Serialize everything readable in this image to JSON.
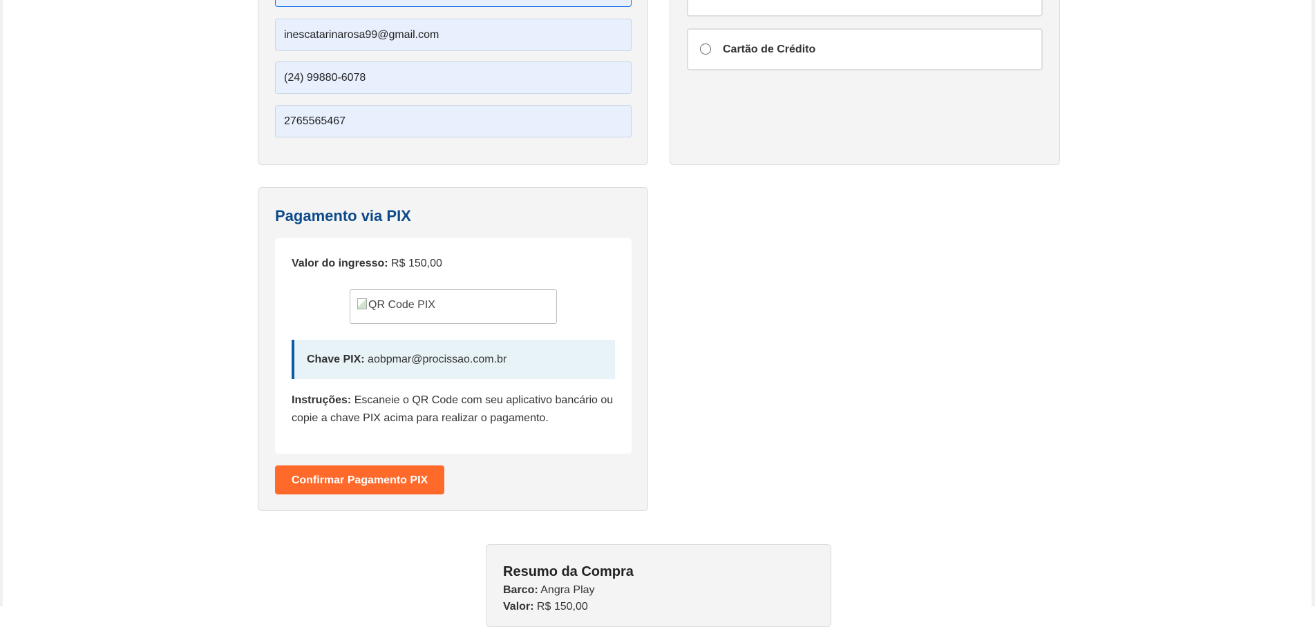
{
  "contact_form": {
    "email_value": "inescatarinarosa99@gmail.com",
    "phone_value": "(24) 99880-6078",
    "document_value": "2765565467"
  },
  "payment_methods": {
    "credit_card_label": "Cartão de Crédito"
  },
  "pix": {
    "title": "Pagamento via PIX",
    "valor_label": "Valor do ingresso:",
    "valor_value": "R$ 150,00",
    "qr_alt": "QR Code PIX",
    "chave_label": "Chave PIX:",
    "chave_value": "aobpmar@procissao.com.br",
    "instrucoes_label": "Instruções:",
    "instrucoes_text": "Escaneie o QR Code com seu aplicativo bancário ou copie a chave PIX acima para realizar o pagamento.",
    "confirm_label": "Confirmar Pagamento PIX"
  },
  "resumo": {
    "title": "Resumo da Compra",
    "barco_label": "Barco:",
    "barco_value": "Angra Play",
    "valor_label": "Valor:",
    "valor_value": "R$ 150,00"
  },
  "colors": {
    "accent_orange": "#ff6a2b",
    "title_blue": "#0d4a8a",
    "input_bg": "#e8f0fe"
  }
}
